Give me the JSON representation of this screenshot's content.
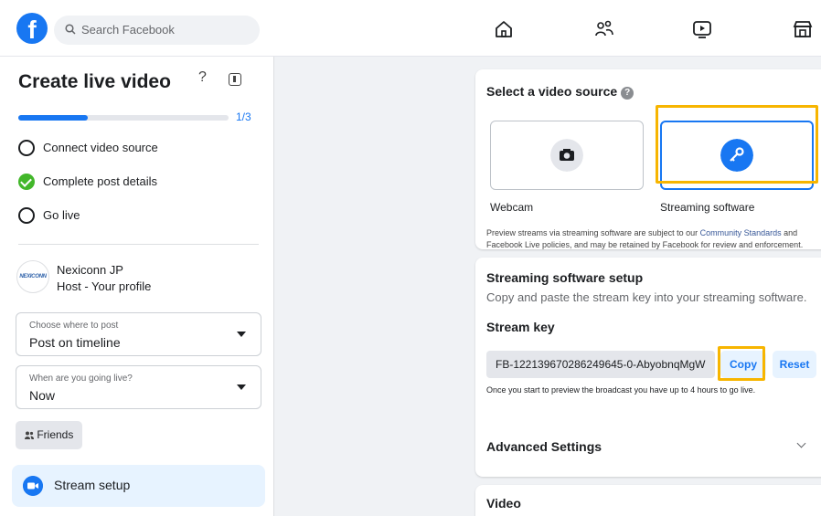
{
  "topbar": {
    "search_placeholder": "Search Facebook",
    "nav_icons": [
      "home-icon",
      "friends-icon",
      "watch-icon",
      "marketplace-icon"
    ]
  },
  "sidebar": {
    "title": "Create live video",
    "help": "?",
    "progress_fraction": 0.33,
    "progress_text": "1/3",
    "steps": [
      {
        "label": "Connect video source",
        "state": "pending"
      },
      {
        "label": "Complete post details",
        "state": "done"
      },
      {
        "label": "Go live",
        "state": "pending"
      }
    ],
    "profile": {
      "avatar_text": "NEXICONN",
      "name": "Nexiconn JP",
      "role": "Host - Your profile"
    },
    "where_to_post": {
      "label": "Choose where to post",
      "value": "Post on timeline"
    },
    "when_live": {
      "label": "When are you going live?",
      "value": "Now"
    },
    "audience_button": "Friends",
    "audience_icon": "friends-icon",
    "stream_setup_label": "Stream setup"
  },
  "video_source": {
    "heading": "Select a video source",
    "help_icon": "?",
    "options": [
      {
        "label": "Webcam",
        "icon": "camera-icon",
        "selected": false
      },
      {
        "label": "Streaming software",
        "icon": "key-icon",
        "selected": true
      }
    ],
    "disclaimer_prefix": "Preview streams via streaming software are subject to our ",
    "disclaimer_link": "Community Standards",
    "disclaimer_suffix": " and Facebook Live policies, and may be retained by Facebook for review and enforcement."
  },
  "streaming_setup": {
    "heading": "Streaming software setup",
    "description": "Copy and paste the stream key into your streaming software.",
    "stream_key_label": "Stream key",
    "stream_key_value": "FB-122139670286249645-0-AbyobnqMgW",
    "copy_label": "Copy",
    "reset_label": "Reset",
    "note": "Once you start to preview the broadcast you have up to 4 hours to go live.",
    "advanced_label": "Advanced Settings"
  },
  "video_section": {
    "heading": "Video"
  },
  "colors": {
    "accent": "#1877f2",
    "highlight": "#f7b500",
    "success": "#42b72a",
    "background": "#f0f2f5"
  }
}
